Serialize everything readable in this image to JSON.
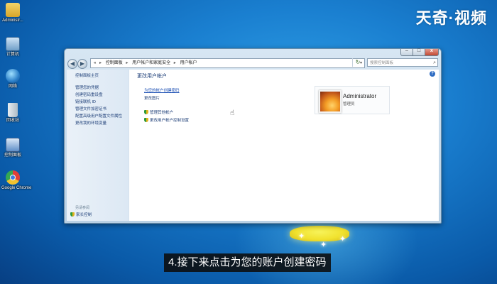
{
  "brand": "天奇·视频",
  "desktop_icons": [
    {
      "label": "Administr...",
      "icon": "folder-icon",
      "color": "#e8c14a"
    },
    {
      "label": "计算机",
      "icon": "computer-icon",
      "color": "#8fb6d8"
    },
    {
      "label": "网络",
      "icon": "network-icon",
      "color": "#5fa3d6"
    },
    {
      "label": "回收站",
      "icon": "recycle-bin-icon",
      "color": "#cfd8de"
    },
    {
      "label": "控制面板",
      "icon": "control-panel-icon",
      "color": "#6f9bd0"
    },
    {
      "label": "Google Chrome",
      "icon": "chrome-icon",
      "color": "#e0403a"
    }
  ],
  "window": {
    "address": {
      "root": "«",
      "crumbs": [
        "控制面板",
        "用户帐户和家庭安全",
        "用户帐户"
      ]
    },
    "search_placeholder": "搜索控制面板",
    "help": "?",
    "sidebar": {
      "home": "控制面板主页",
      "links": [
        "管理您的凭据",
        "创建密码重设盘",
        "链接联机 ID",
        "管理文件加密证书",
        "配置高级用户配置文件属性",
        "更改我的环境变量"
      ],
      "see_also": "另请参阅",
      "parental": "家长控制"
    },
    "main": {
      "title": "更改用户帐户",
      "tasks": [
        "为您的帐户创建密码",
        "更改图片",
        "管理其他帐户",
        "更改用户帐户控制设置"
      ]
    },
    "account": {
      "name": "Administrator",
      "role": "管理员"
    }
  },
  "subtitle": "4.接下来点击为您的账户创建密码"
}
